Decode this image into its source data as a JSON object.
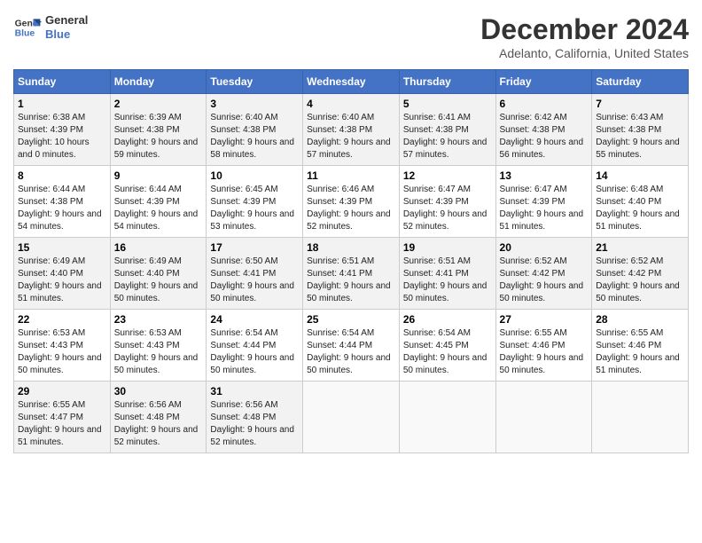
{
  "header": {
    "logo_line1": "General",
    "logo_line2": "Blue",
    "month": "December 2024",
    "location": "Adelanto, California, United States"
  },
  "weekdays": [
    "Sunday",
    "Monday",
    "Tuesday",
    "Wednesday",
    "Thursday",
    "Friday",
    "Saturday"
  ],
  "weeks": [
    [
      {
        "day": "1",
        "sunrise": "Sunrise: 6:38 AM",
        "sunset": "Sunset: 4:39 PM",
        "daylight": "Daylight: 10 hours and 0 minutes."
      },
      {
        "day": "2",
        "sunrise": "Sunrise: 6:39 AM",
        "sunset": "Sunset: 4:38 PM",
        "daylight": "Daylight: 9 hours and 59 minutes."
      },
      {
        "day": "3",
        "sunrise": "Sunrise: 6:40 AM",
        "sunset": "Sunset: 4:38 PM",
        "daylight": "Daylight: 9 hours and 58 minutes."
      },
      {
        "day": "4",
        "sunrise": "Sunrise: 6:40 AM",
        "sunset": "Sunset: 4:38 PM",
        "daylight": "Daylight: 9 hours and 57 minutes."
      },
      {
        "day": "5",
        "sunrise": "Sunrise: 6:41 AM",
        "sunset": "Sunset: 4:38 PM",
        "daylight": "Daylight: 9 hours and 57 minutes."
      },
      {
        "day": "6",
        "sunrise": "Sunrise: 6:42 AM",
        "sunset": "Sunset: 4:38 PM",
        "daylight": "Daylight: 9 hours and 56 minutes."
      },
      {
        "day": "7",
        "sunrise": "Sunrise: 6:43 AM",
        "sunset": "Sunset: 4:38 PM",
        "daylight": "Daylight: 9 hours and 55 minutes."
      }
    ],
    [
      {
        "day": "8",
        "sunrise": "Sunrise: 6:44 AM",
        "sunset": "Sunset: 4:38 PM",
        "daylight": "Daylight: 9 hours and 54 minutes."
      },
      {
        "day": "9",
        "sunrise": "Sunrise: 6:44 AM",
        "sunset": "Sunset: 4:39 PM",
        "daylight": "Daylight: 9 hours and 54 minutes."
      },
      {
        "day": "10",
        "sunrise": "Sunrise: 6:45 AM",
        "sunset": "Sunset: 4:39 PM",
        "daylight": "Daylight: 9 hours and 53 minutes."
      },
      {
        "day": "11",
        "sunrise": "Sunrise: 6:46 AM",
        "sunset": "Sunset: 4:39 PM",
        "daylight": "Daylight: 9 hours and 52 minutes."
      },
      {
        "day": "12",
        "sunrise": "Sunrise: 6:47 AM",
        "sunset": "Sunset: 4:39 PM",
        "daylight": "Daylight: 9 hours and 52 minutes."
      },
      {
        "day": "13",
        "sunrise": "Sunrise: 6:47 AM",
        "sunset": "Sunset: 4:39 PM",
        "daylight": "Daylight: 9 hours and 51 minutes."
      },
      {
        "day": "14",
        "sunrise": "Sunrise: 6:48 AM",
        "sunset": "Sunset: 4:40 PM",
        "daylight": "Daylight: 9 hours and 51 minutes."
      }
    ],
    [
      {
        "day": "15",
        "sunrise": "Sunrise: 6:49 AM",
        "sunset": "Sunset: 4:40 PM",
        "daylight": "Daylight: 9 hours and 51 minutes."
      },
      {
        "day": "16",
        "sunrise": "Sunrise: 6:49 AM",
        "sunset": "Sunset: 4:40 PM",
        "daylight": "Daylight: 9 hours and 50 minutes."
      },
      {
        "day": "17",
        "sunrise": "Sunrise: 6:50 AM",
        "sunset": "Sunset: 4:41 PM",
        "daylight": "Daylight: 9 hours and 50 minutes."
      },
      {
        "day": "18",
        "sunrise": "Sunrise: 6:51 AM",
        "sunset": "Sunset: 4:41 PM",
        "daylight": "Daylight: 9 hours and 50 minutes."
      },
      {
        "day": "19",
        "sunrise": "Sunrise: 6:51 AM",
        "sunset": "Sunset: 4:41 PM",
        "daylight": "Daylight: 9 hours and 50 minutes."
      },
      {
        "day": "20",
        "sunrise": "Sunrise: 6:52 AM",
        "sunset": "Sunset: 4:42 PM",
        "daylight": "Daylight: 9 hours and 50 minutes."
      },
      {
        "day": "21",
        "sunrise": "Sunrise: 6:52 AM",
        "sunset": "Sunset: 4:42 PM",
        "daylight": "Daylight: 9 hours and 50 minutes."
      }
    ],
    [
      {
        "day": "22",
        "sunrise": "Sunrise: 6:53 AM",
        "sunset": "Sunset: 4:43 PM",
        "daylight": "Daylight: 9 hours and 50 minutes."
      },
      {
        "day": "23",
        "sunrise": "Sunrise: 6:53 AM",
        "sunset": "Sunset: 4:43 PM",
        "daylight": "Daylight: 9 hours and 50 minutes."
      },
      {
        "day": "24",
        "sunrise": "Sunrise: 6:54 AM",
        "sunset": "Sunset: 4:44 PM",
        "daylight": "Daylight: 9 hours and 50 minutes."
      },
      {
        "day": "25",
        "sunrise": "Sunrise: 6:54 AM",
        "sunset": "Sunset: 4:44 PM",
        "daylight": "Daylight: 9 hours and 50 minutes."
      },
      {
        "day": "26",
        "sunrise": "Sunrise: 6:54 AM",
        "sunset": "Sunset: 4:45 PM",
        "daylight": "Daylight: 9 hours and 50 minutes."
      },
      {
        "day": "27",
        "sunrise": "Sunrise: 6:55 AM",
        "sunset": "Sunset: 4:46 PM",
        "daylight": "Daylight: 9 hours and 50 minutes."
      },
      {
        "day": "28",
        "sunrise": "Sunrise: 6:55 AM",
        "sunset": "Sunset: 4:46 PM",
        "daylight": "Daylight: 9 hours and 51 minutes."
      }
    ],
    [
      {
        "day": "29",
        "sunrise": "Sunrise: 6:55 AM",
        "sunset": "Sunset: 4:47 PM",
        "daylight": "Daylight: 9 hours and 51 minutes."
      },
      {
        "day": "30",
        "sunrise": "Sunrise: 6:56 AM",
        "sunset": "Sunset: 4:48 PM",
        "daylight": "Daylight: 9 hours and 52 minutes."
      },
      {
        "day": "31",
        "sunrise": "Sunrise: 6:56 AM",
        "sunset": "Sunset: 4:48 PM",
        "daylight": "Daylight: 9 hours and 52 minutes."
      },
      null,
      null,
      null,
      null
    ]
  ]
}
